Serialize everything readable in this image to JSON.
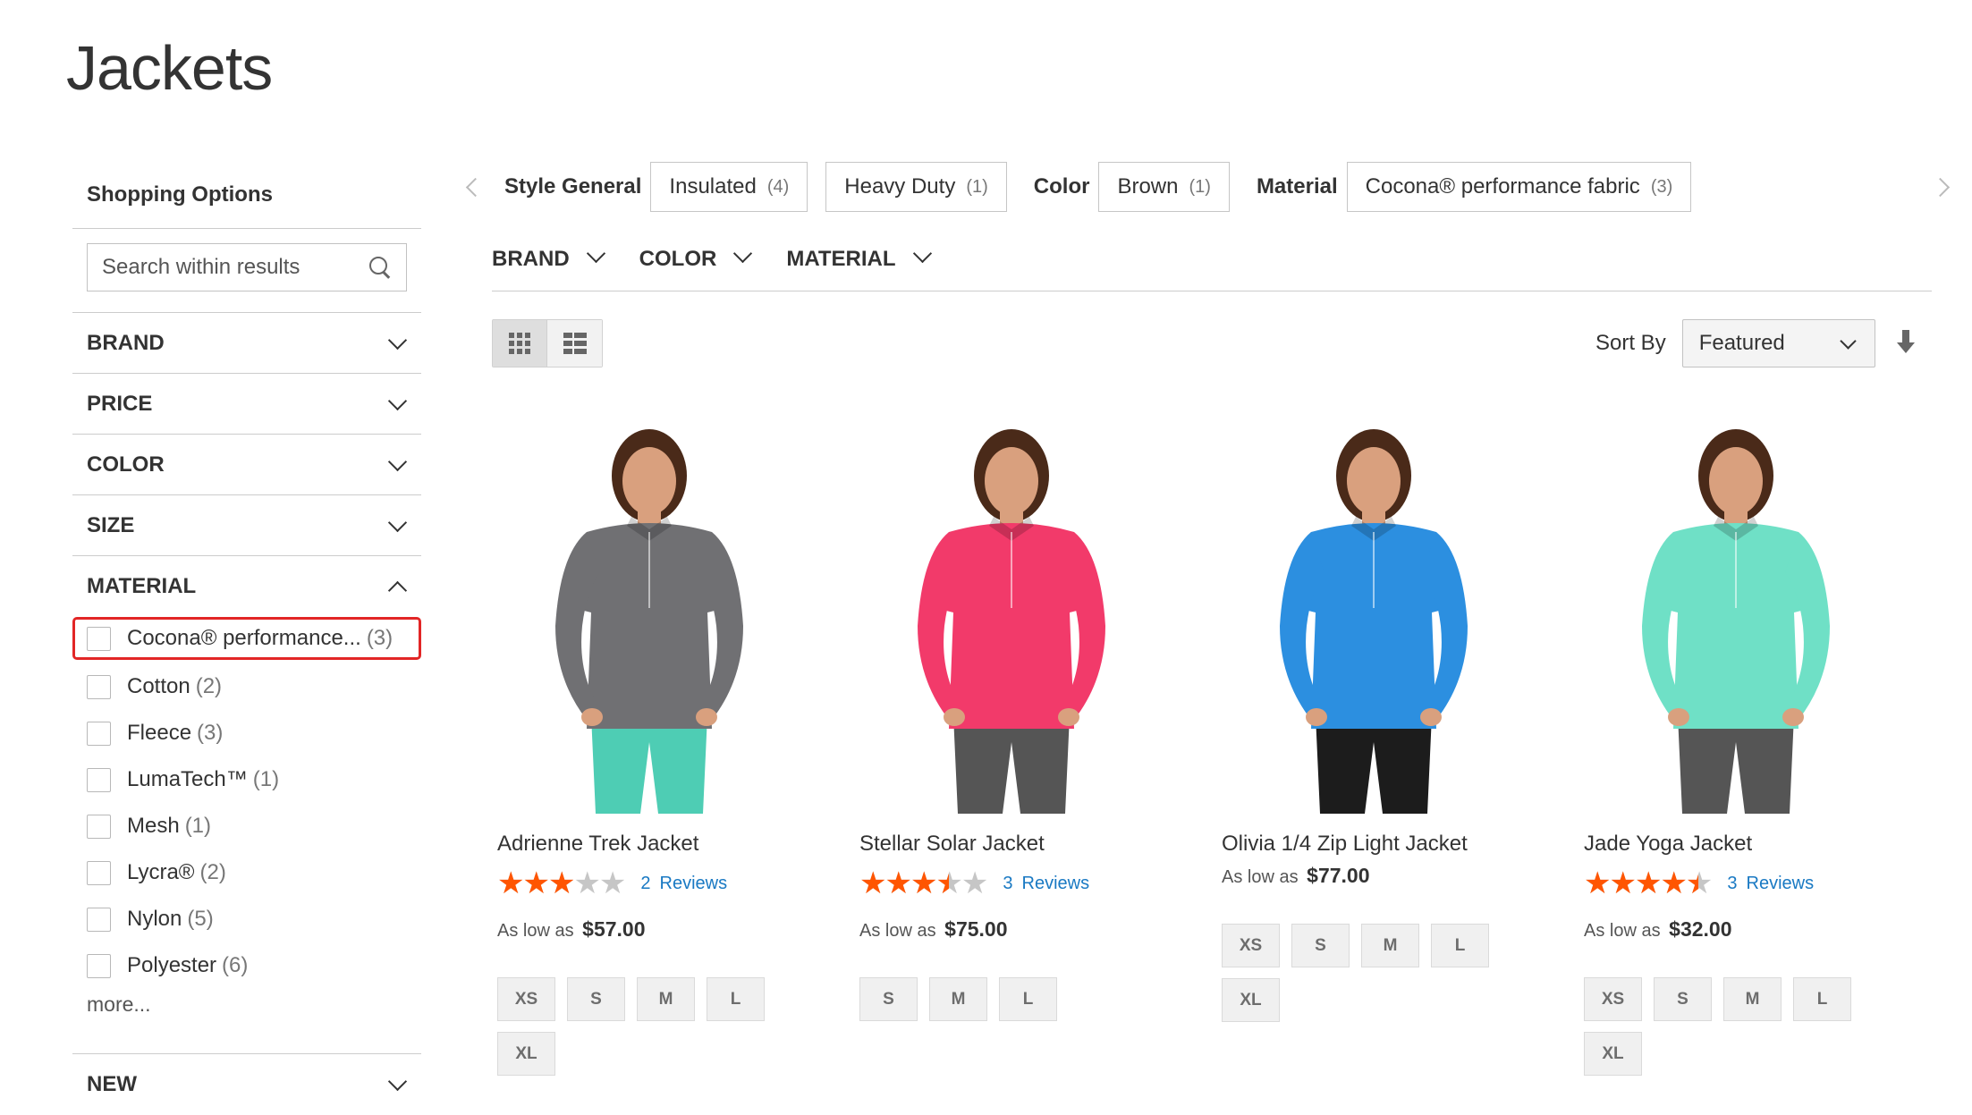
{
  "page_title": "Jackets",
  "sidebar": {
    "title": "Shopping Options",
    "search_placeholder": "Search within results",
    "filters": [
      "BRAND",
      "PRICE",
      "COLOR",
      "SIZE"
    ],
    "material": {
      "label": "MATERIAL",
      "options": [
        {
          "label": "Cocona® performance...",
          "count": "(3)"
        },
        {
          "label": "Cotton",
          "count": "(2)"
        },
        {
          "label": "Fleece",
          "count": "(3)"
        },
        {
          "label": "LumaTech™",
          "count": "(1)"
        },
        {
          "label": "Mesh",
          "count": "(1)"
        },
        {
          "label": "Lycra®",
          "count": "(2)"
        },
        {
          "label": "Nylon",
          "count": "(5)"
        },
        {
          "label": "Polyester",
          "count": "(6)"
        }
      ],
      "more": "more..."
    },
    "new_label": "NEW"
  },
  "chips": {
    "style_label": "Style General",
    "style_items": [
      {
        "label": "Insulated",
        "count": "(4)"
      },
      {
        "label": "Heavy Duty",
        "count": "(1)"
      }
    ],
    "color_label": "Color",
    "color_items": [
      {
        "label": "Brown",
        "count": "(1)"
      }
    ],
    "material_label": "Material",
    "material_items": [
      {
        "label": "Cocona® performance fabric",
        "count": "(3)"
      }
    ]
  },
  "dropdowns": [
    "BRAND",
    "COLOR",
    "MATERIAL"
  ],
  "toolbar": {
    "sort_label": "Sort By",
    "sort_value": "Featured"
  },
  "products": [
    {
      "name": "Adrienne Trek Jacket",
      "rating": 3,
      "reviews_count": "2",
      "reviews_label": "Reviews",
      "price_prefix": "As low as",
      "price": "$57.00",
      "sizes": [
        "XS",
        "S",
        "M",
        "L",
        "XL"
      ],
      "color": "#707073",
      "pants": "#4ecdb4"
    },
    {
      "name": "Stellar Solar Jacket",
      "rating": 3.5,
      "reviews_count": "3",
      "reviews_label": "Reviews",
      "price_prefix": "As low as",
      "price": "$75.00",
      "sizes": [
        "S",
        "M",
        "L"
      ],
      "color": "#f23a6a",
      "pants": "#555555"
    },
    {
      "name": "Olivia 1/4 Zip Light Jacket",
      "rating": null,
      "reviews_count": "",
      "reviews_label": "",
      "price_prefix": "As low as",
      "price": "$77.00",
      "sizes": [
        "XS",
        "S",
        "M",
        "L",
        "XL"
      ],
      "color": "#2c8fe0",
      "pants": "#1c1c1c"
    },
    {
      "name": "Jade Yoga Jacket",
      "rating": 4.5,
      "reviews_count": "3",
      "reviews_label": "Reviews",
      "price_prefix": "As low as",
      "price": "$32.00",
      "sizes": [
        "XS",
        "S",
        "M",
        "L",
        "XL"
      ],
      "color": "#6fe0c6",
      "pants": "#555555"
    }
  ]
}
